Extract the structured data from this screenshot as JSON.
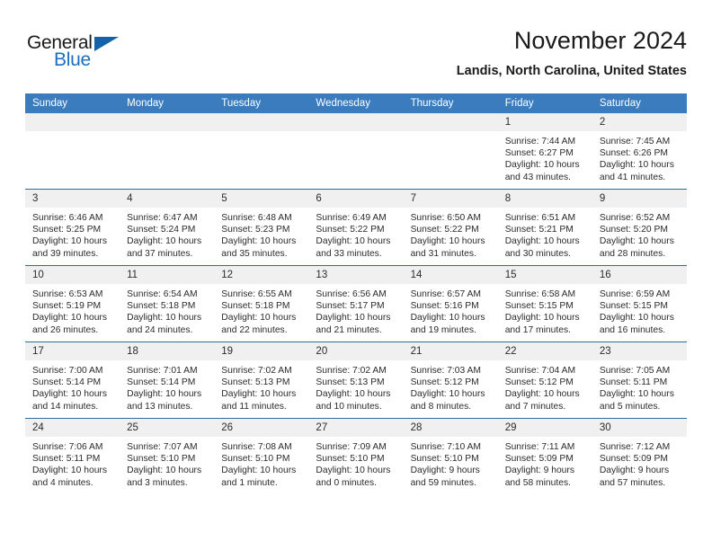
{
  "brand": {
    "name_part1": "General",
    "name_part2": "Blue",
    "accent_color": "#1263ac"
  },
  "header": {
    "title": "November 2024",
    "location": "Landis, North Carolina, United States"
  },
  "calendar": {
    "header_bg": "#3a7cbe",
    "daynum_bg": "#f0f0f0",
    "weekday_names": [
      "Sunday",
      "Monday",
      "Tuesday",
      "Wednesday",
      "Thursday",
      "Friday",
      "Saturday"
    ],
    "weeks": [
      [
        {
          "day": "",
          "blank": true,
          "sunrise": "",
          "sunset": "",
          "daylight1": "",
          "daylight2": ""
        },
        {
          "day": "",
          "blank": true,
          "sunrise": "",
          "sunset": "",
          "daylight1": "",
          "daylight2": ""
        },
        {
          "day": "",
          "blank": true,
          "sunrise": "",
          "sunset": "",
          "daylight1": "",
          "daylight2": ""
        },
        {
          "day": "",
          "blank": true,
          "sunrise": "",
          "sunset": "",
          "daylight1": "",
          "daylight2": ""
        },
        {
          "day": "",
          "blank": true,
          "sunrise": "",
          "sunset": "",
          "daylight1": "",
          "daylight2": ""
        },
        {
          "day": "1",
          "blank": false,
          "sunrise": "Sunrise: 7:44 AM",
          "sunset": "Sunset: 6:27 PM",
          "daylight1": "Daylight: 10 hours",
          "daylight2": "and 43 minutes."
        },
        {
          "day": "2",
          "blank": false,
          "sunrise": "Sunrise: 7:45 AM",
          "sunset": "Sunset: 6:26 PM",
          "daylight1": "Daylight: 10 hours",
          "daylight2": "and 41 minutes."
        }
      ],
      [
        {
          "day": "3",
          "blank": false,
          "sunrise": "Sunrise: 6:46 AM",
          "sunset": "Sunset: 5:25 PM",
          "daylight1": "Daylight: 10 hours",
          "daylight2": "and 39 minutes."
        },
        {
          "day": "4",
          "blank": false,
          "sunrise": "Sunrise: 6:47 AM",
          "sunset": "Sunset: 5:24 PM",
          "daylight1": "Daylight: 10 hours",
          "daylight2": "and 37 minutes."
        },
        {
          "day": "5",
          "blank": false,
          "sunrise": "Sunrise: 6:48 AM",
          "sunset": "Sunset: 5:23 PM",
          "daylight1": "Daylight: 10 hours",
          "daylight2": "and 35 minutes."
        },
        {
          "day": "6",
          "blank": false,
          "sunrise": "Sunrise: 6:49 AM",
          "sunset": "Sunset: 5:22 PM",
          "daylight1": "Daylight: 10 hours",
          "daylight2": "and 33 minutes."
        },
        {
          "day": "7",
          "blank": false,
          "sunrise": "Sunrise: 6:50 AM",
          "sunset": "Sunset: 5:22 PM",
          "daylight1": "Daylight: 10 hours",
          "daylight2": "and 31 minutes."
        },
        {
          "day": "8",
          "blank": false,
          "sunrise": "Sunrise: 6:51 AM",
          "sunset": "Sunset: 5:21 PM",
          "daylight1": "Daylight: 10 hours",
          "daylight2": "and 30 minutes."
        },
        {
          "day": "9",
          "blank": false,
          "sunrise": "Sunrise: 6:52 AM",
          "sunset": "Sunset: 5:20 PM",
          "daylight1": "Daylight: 10 hours",
          "daylight2": "and 28 minutes."
        }
      ],
      [
        {
          "day": "10",
          "blank": false,
          "sunrise": "Sunrise: 6:53 AM",
          "sunset": "Sunset: 5:19 PM",
          "daylight1": "Daylight: 10 hours",
          "daylight2": "and 26 minutes."
        },
        {
          "day": "11",
          "blank": false,
          "sunrise": "Sunrise: 6:54 AM",
          "sunset": "Sunset: 5:18 PM",
          "daylight1": "Daylight: 10 hours",
          "daylight2": "and 24 minutes."
        },
        {
          "day": "12",
          "blank": false,
          "sunrise": "Sunrise: 6:55 AM",
          "sunset": "Sunset: 5:18 PM",
          "daylight1": "Daylight: 10 hours",
          "daylight2": "and 22 minutes."
        },
        {
          "day": "13",
          "blank": false,
          "sunrise": "Sunrise: 6:56 AM",
          "sunset": "Sunset: 5:17 PM",
          "daylight1": "Daylight: 10 hours",
          "daylight2": "and 21 minutes."
        },
        {
          "day": "14",
          "blank": false,
          "sunrise": "Sunrise: 6:57 AM",
          "sunset": "Sunset: 5:16 PM",
          "daylight1": "Daylight: 10 hours",
          "daylight2": "and 19 minutes."
        },
        {
          "day": "15",
          "blank": false,
          "sunrise": "Sunrise: 6:58 AM",
          "sunset": "Sunset: 5:15 PM",
          "daylight1": "Daylight: 10 hours",
          "daylight2": "and 17 minutes."
        },
        {
          "day": "16",
          "blank": false,
          "sunrise": "Sunrise: 6:59 AM",
          "sunset": "Sunset: 5:15 PM",
          "daylight1": "Daylight: 10 hours",
          "daylight2": "and 16 minutes."
        }
      ],
      [
        {
          "day": "17",
          "blank": false,
          "sunrise": "Sunrise: 7:00 AM",
          "sunset": "Sunset: 5:14 PM",
          "daylight1": "Daylight: 10 hours",
          "daylight2": "and 14 minutes."
        },
        {
          "day": "18",
          "blank": false,
          "sunrise": "Sunrise: 7:01 AM",
          "sunset": "Sunset: 5:14 PM",
          "daylight1": "Daylight: 10 hours",
          "daylight2": "and 13 minutes."
        },
        {
          "day": "19",
          "blank": false,
          "sunrise": "Sunrise: 7:02 AM",
          "sunset": "Sunset: 5:13 PM",
          "daylight1": "Daylight: 10 hours",
          "daylight2": "and 11 minutes."
        },
        {
          "day": "20",
          "blank": false,
          "sunrise": "Sunrise: 7:02 AM",
          "sunset": "Sunset: 5:13 PM",
          "daylight1": "Daylight: 10 hours",
          "daylight2": "and 10 minutes."
        },
        {
          "day": "21",
          "blank": false,
          "sunrise": "Sunrise: 7:03 AM",
          "sunset": "Sunset: 5:12 PM",
          "daylight1": "Daylight: 10 hours",
          "daylight2": "and 8 minutes."
        },
        {
          "day": "22",
          "blank": false,
          "sunrise": "Sunrise: 7:04 AM",
          "sunset": "Sunset: 5:12 PM",
          "daylight1": "Daylight: 10 hours",
          "daylight2": "and 7 minutes."
        },
        {
          "day": "23",
          "blank": false,
          "sunrise": "Sunrise: 7:05 AM",
          "sunset": "Sunset: 5:11 PM",
          "daylight1": "Daylight: 10 hours",
          "daylight2": "and 5 minutes."
        }
      ],
      [
        {
          "day": "24",
          "blank": false,
          "sunrise": "Sunrise: 7:06 AM",
          "sunset": "Sunset: 5:11 PM",
          "daylight1": "Daylight: 10 hours",
          "daylight2": "and 4 minutes."
        },
        {
          "day": "25",
          "blank": false,
          "sunrise": "Sunrise: 7:07 AM",
          "sunset": "Sunset: 5:10 PM",
          "daylight1": "Daylight: 10 hours",
          "daylight2": "and 3 minutes."
        },
        {
          "day": "26",
          "blank": false,
          "sunrise": "Sunrise: 7:08 AM",
          "sunset": "Sunset: 5:10 PM",
          "daylight1": "Daylight: 10 hours",
          "daylight2": "and 1 minute."
        },
        {
          "day": "27",
          "blank": false,
          "sunrise": "Sunrise: 7:09 AM",
          "sunset": "Sunset: 5:10 PM",
          "daylight1": "Daylight: 10 hours",
          "daylight2": "and 0 minutes."
        },
        {
          "day": "28",
          "blank": false,
          "sunrise": "Sunrise: 7:10 AM",
          "sunset": "Sunset: 5:10 PM",
          "daylight1": "Daylight: 9 hours",
          "daylight2": "and 59 minutes."
        },
        {
          "day": "29",
          "blank": false,
          "sunrise": "Sunrise: 7:11 AM",
          "sunset": "Sunset: 5:09 PM",
          "daylight1": "Daylight: 9 hours",
          "daylight2": "and 58 minutes."
        },
        {
          "day": "30",
          "blank": false,
          "sunrise": "Sunrise: 7:12 AM",
          "sunset": "Sunset: 5:09 PM",
          "daylight1": "Daylight: 9 hours",
          "daylight2": "and 57 minutes."
        }
      ]
    ]
  }
}
